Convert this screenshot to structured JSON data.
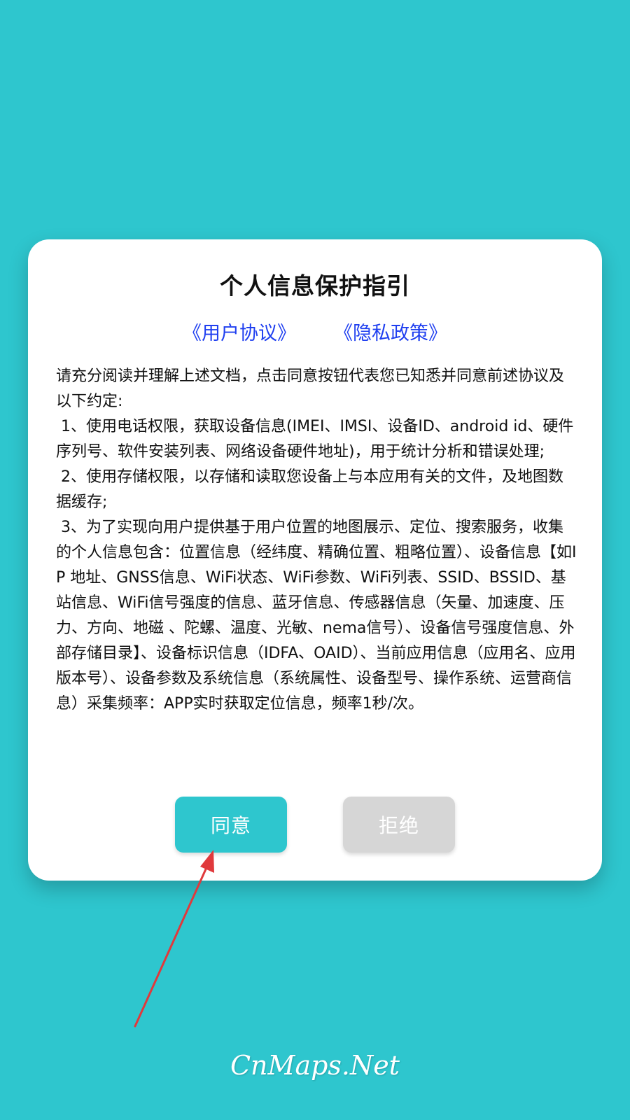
{
  "dialog": {
    "title": "个人信息保护指引",
    "links": {
      "user_agreement": "《用户协议》",
      "privacy_policy": "《隐私政策》"
    },
    "body": "请充分阅读并理解上述文档，点击同意按钮代表您已知悉并同意前述协议及以下约定:\n 1、使用电话权限，获取设备信息(IMEI、IMSI、设备ID、android id、硬件序列号、软件安装列表、网络设备硬件地址)，用于统计分析和错误处理;\n 2、使用存储权限，以存储和读取您设备上与本应用有关的文件，及地图数据缓存;\n 3、为了实现向用户提供基于用户位置的地图展示、定位、搜索服务，收集的个人信息包含：位置信息（经纬度、精确位置、粗略位置）、设备信息【如IP 地址、GNSS信息、WiFi状态、WiFi参数、WiFi列表、SSID、BSSID、基站信息、WiFi信号强度的信息、蓝牙信息、传感器信息（矢量、加速度、压力、方向、地磁 、陀螺、温度、光敏、nema信号）、设备信号强度信息、外部存储目录】、设备标识信息（IDFA、OAID）、当前应用信息（应用名、应用版本号）、设备参数及系统信息（系统属性、设备型号、操作系统、运营商信息）采集频率：APP实时获取定位信息，频率1秒/次。",
    "agree_label": "同意",
    "refuse_label": "拒绝"
  },
  "watermark": "CnMaps.Net",
  "colors": {
    "background": "#2ec6ce",
    "link": "#1f3ff0",
    "agree_button": "#2ec6ce",
    "refuse_button": "#d6d6d6",
    "arrow": "#e0393c"
  },
  "icons": {
    "annotation": "arrow-annotation-icon"
  }
}
